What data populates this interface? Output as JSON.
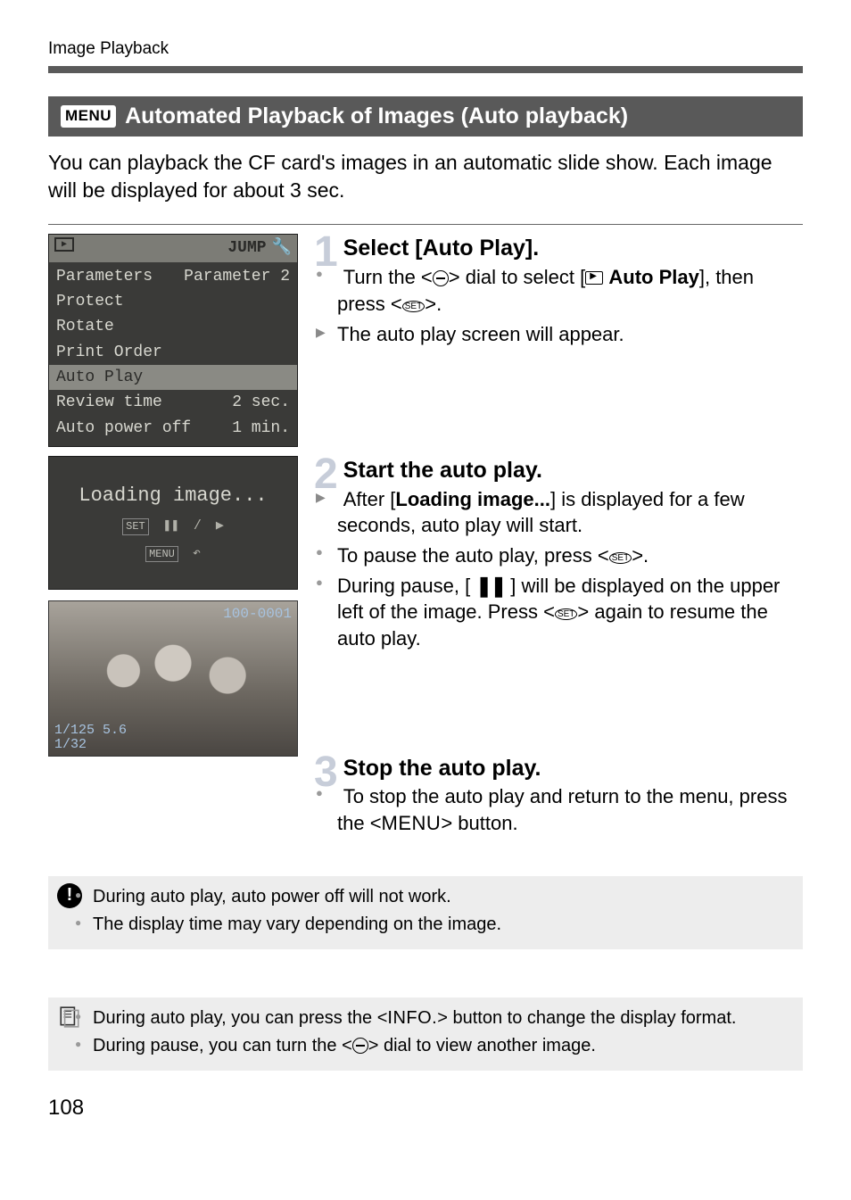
{
  "chapter": "Image Playback",
  "section": {
    "badge": "MENU",
    "title": "Automated Playback of Images (Auto playback)"
  },
  "intro": "You can playback the CF card's images in an automatic slide show. Each image will be displayed for about 3 sec.",
  "lcd_menu": {
    "top_right": "JUMP",
    "rows": [
      {
        "l": "Parameters",
        "r": "Parameter 2"
      },
      {
        "l": "Protect",
        "r": ""
      },
      {
        "l": "Rotate",
        "r": ""
      },
      {
        "l": "Print Order",
        "r": ""
      },
      {
        "l": "Auto Play",
        "r": "",
        "selected": true
      },
      {
        "l": "Review time",
        "r": "2 sec."
      },
      {
        "l": "Auto power off",
        "r": "1 min."
      }
    ]
  },
  "lcd_loading": {
    "text": "Loading image...",
    "tags": [
      "SET",
      "MENU"
    ]
  },
  "photo_overlay": {
    "file": "100-0001",
    "exposure": "1/125  5.6",
    "frame": "1/32"
  },
  "steps": [
    {
      "num": "1",
      "title": "Select [Auto Play].",
      "bullets": [
        {
          "type": "dot",
          "html": "Turn the <{DIAL}> dial to select [{PLAYICON} <b>Auto Play</b>], then press <{SET}>."
        },
        {
          "type": "arrow",
          "html": "The auto play screen will appear."
        }
      ]
    },
    {
      "num": "2",
      "title": "Start the auto play.",
      "bullets": [
        {
          "type": "arrow",
          "html": "After [<b>Loading image...</b>] is displayed for a few seconds, auto play will start."
        },
        {
          "type": "dot",
          "html": "To pause the auto play, press <{SET}>."
        },
        {
          "type": "dot",
          "html": "During pause, [ {PAUSE} ] will be displayed on the upper left of the image. Press <{SET}> again to resume the auto play."
        }
      ]
    },
    {
      "num": "3",
      "title": "Stop the auto play.",
      "bullets": [
        {
          "type": "dot",
          "html": "To stop the auto play and return to the menu, press the <<span class=\"menu-word\">MENU</span>> button."
        }
      ]
    }
  ],
  "notes_warn": [
    "During auto play, auto power off will not work.",
    "The display time may vary depending on the image."
  ],
  "notes_tips": [
    "During auto play, you can press the <<span class=\"info-word\">INFO.</span>> button to change the display format.",
    "During pause, you can turn the <{DIAL}> dial to view another image."
  ],
  "page_number": "108"
}
